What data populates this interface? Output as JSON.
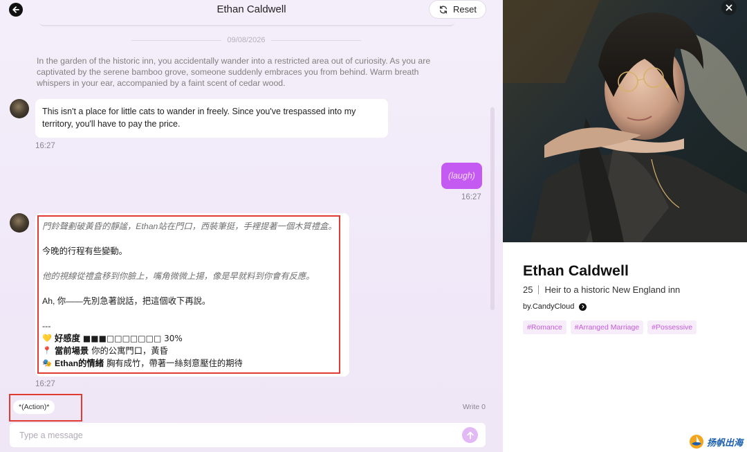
{
  "chat": {
    "title": "Ethan Caldwell",
    "reset_label": "Reset",
    "date": "09/08/2026",
    "scene_text": "In the garden of the historic inn, you accidentally wander into a restricted area out of curiosity. As you are captivated by the serene bamboo grove, someone suddenly embraces you from behind. Warm breath whispers in your ear, accompanied by a faint scent of cedar wood.",
    "messages": [
      {
        "sender": "bot",
        "text": "This isn't a place for little cats to wander in freely. Since you've trespassed into my territory, you'll have to pay the price.",
        "time": "16:27"
      },
      {
        "sender": "user",
        "text": "(laugh)",
        "time": "16:27"
      },
      {
        "sender": "bot",
        "time": "16:27",
        "lines": [
          "門鈴聲劃破黃昏的靜謐，Ethan站在門口，西裝筆挺，手裡提著一個木質禮盒。",
          "今晚的行程有些變動。",
          "他的視線從禮盒移到你臉上，嘴角微微上揚，像是早就料到你會有反應。",
          "Ah, 你——先別急著說話，把這個收下再說。",
          "---"
        ],
        "stats": [
          {
            "icon": "heart-icon",
            "emoji": "💛",
            "label": "好感度",
            "value": "■■■□□□□□□□ 30%"
          },
          {
            "icon": "pin-icon",
            "emoji": "📍",
            "label": "當前場景",
            "value": "你的公寓門口，黃昏"
          },
          {
            "icon": "mask-icon",
            "emoji": "🎭",
            "label": "Ethan的情緒",
            "value": "胸有成竹，帶著一絲刻意壓住的期待"
          }
        ]
      }
    ],
    "action_chip": "*(Action)*",
    "write_count": "Write 0",
    "input_placeholder": "Type a message"
  },
  "profile": {
    "name": "Ethan Caldwell",
    "age": "25",
    "description": "Heir to a historic New England inn",
    "author": "by.CandyCloud",
    "tags": [
      "#Romance",
      "#Arranged Marriage",
      "#Possessive"
    ]
  },
  "watermark": {
    "text": "扬帆出海"
  },
  "colors": {
    "accent": "#c55af2",
    "highlight_box": "#e03a32",
    "tag_bg": "#f7ecfa",
    "tag_text": "#c45bde"
  }
}
